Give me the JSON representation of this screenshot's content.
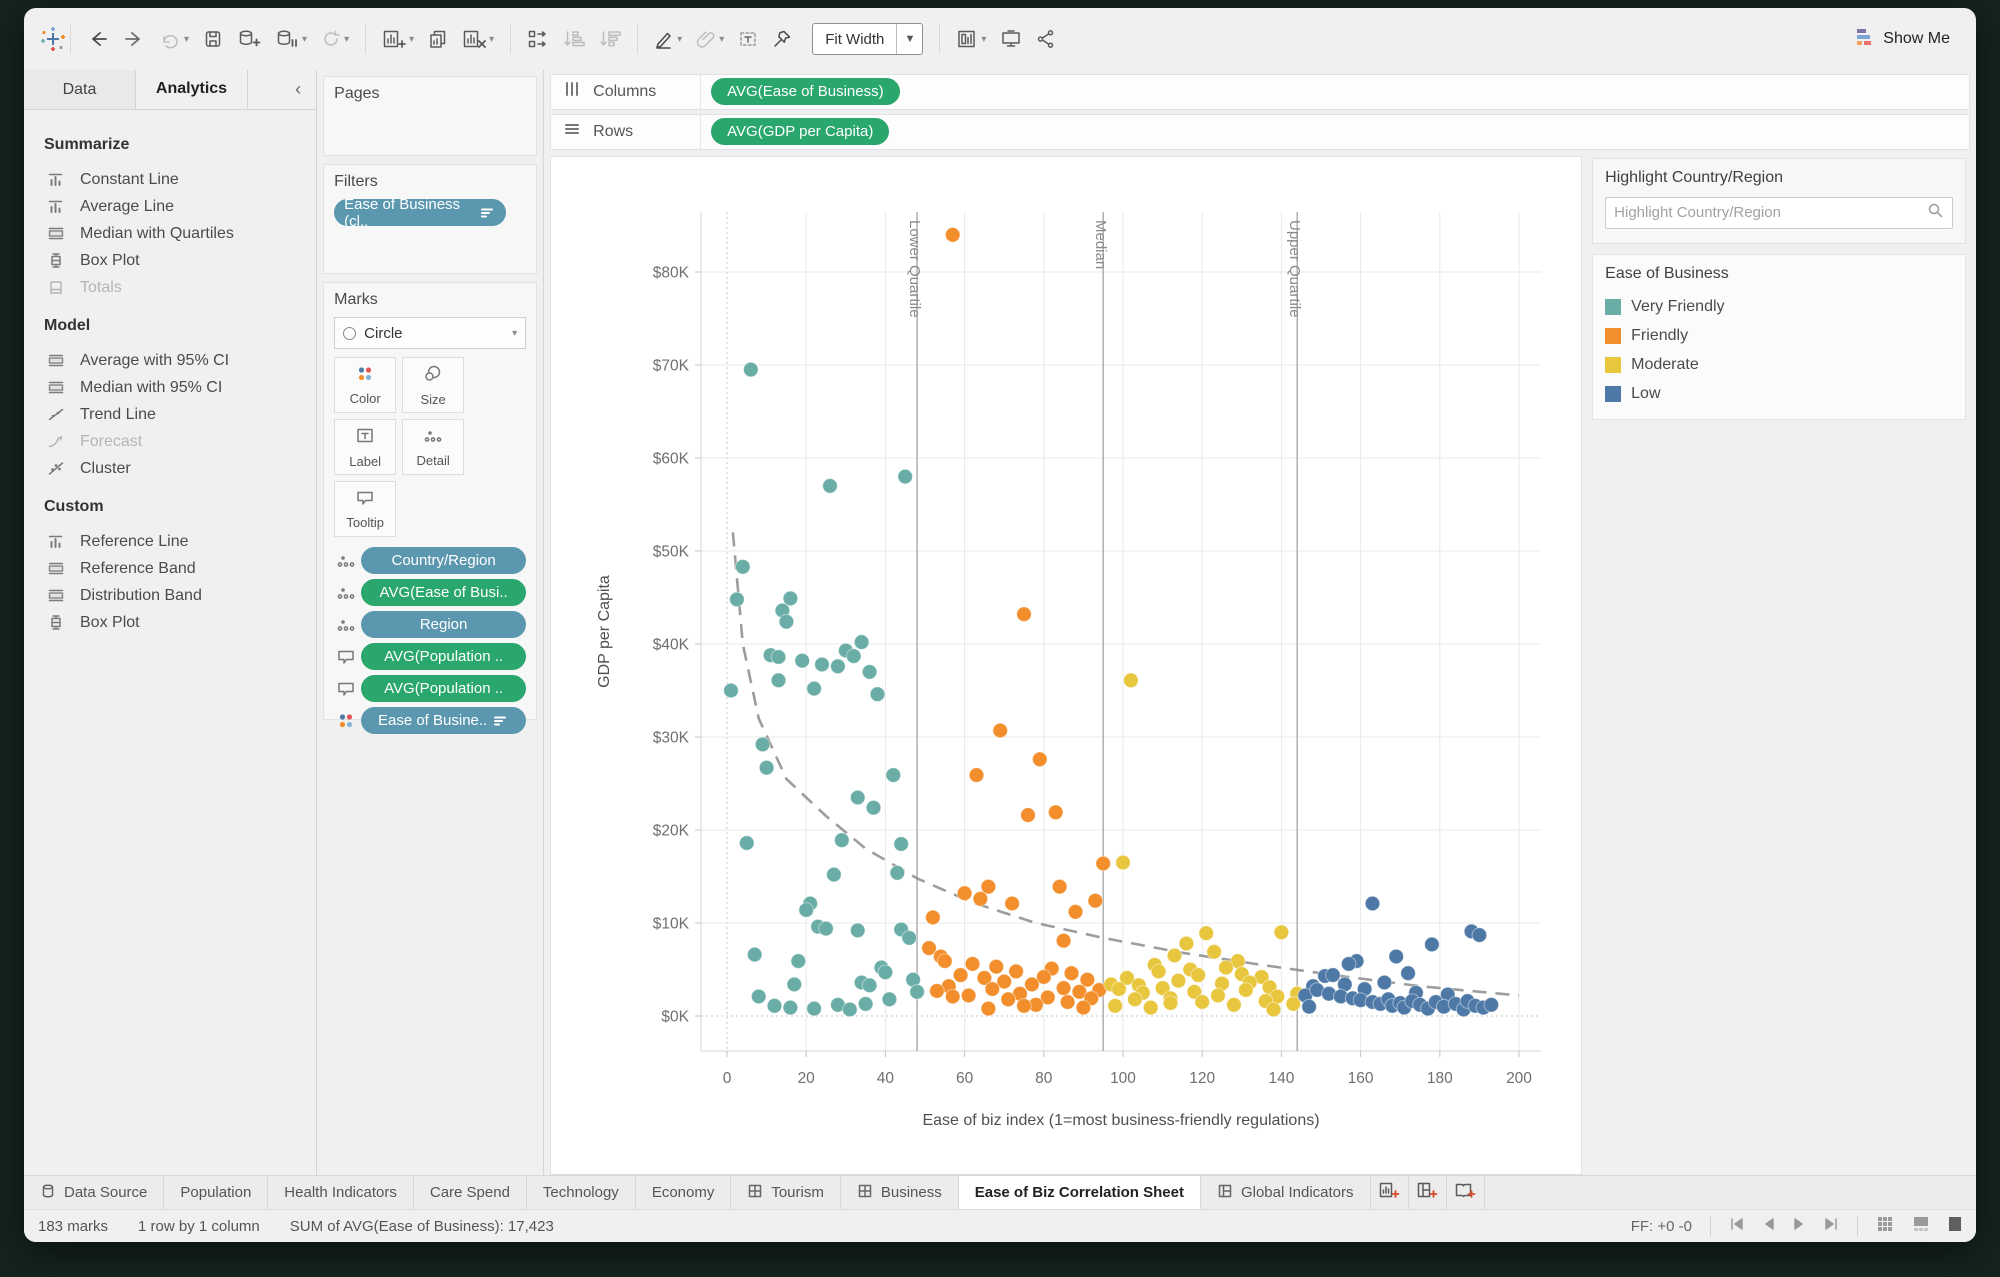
{
  "toolbar": {
    "fit_width": "Fit Width",
    "show_me": "Show Me"
  },
  "sidebar": {
    "tabs": [
      {
        "label": "Data"
      },
      {
        "label": "Analytics",
        "active": true
      }
    ],
    "sections": [
      {
        "title": "Summarize",
        "items": [
          {
            "label": "Constant Line",
            "icon": "ref-line"
          },
          {
            "label": "Average Line",
            "icon": "ref-line"
          },
          {
            "label": "Median with Quartiles",
            "icon": "band"
          },
          {
            "label": "Box Plot",
            "icon": "boxplot"
          },
          {
            "label": "Totals",
            "icon": "totals",
            "disabled": true
          }
        ]
      },
      {
        "title": "Model",
        "items": [
          {
            "label": "Average with 95% CI",
            "icon": "band"
          },
          {
            "label": "Median with 95% CI",
            "icon": "band"
          },
          {
            "label": "Trend Line",
            "icon": "trend"
          },
          {
            "label": "Forecast",
            "icon": "forecast",
            "disabled": true
          },
          {
            "label": "Cluster",
            "icon": "cluster"
          }
        ]
      },
      {
        "title": "Custom",
        "items": [
          {
            "label": "Reference Line",
            "icon": "ref-line"
          },
          {
            "label": "Reference Band",
            "icon": "band"
          },
          {
            "label": "Distribution Band",
            "icon": "band"
          },
          {
            "label": "Box Plot",
            "icon": "boxplot"
          }
        ]
      }
    ]
  },
  "shelves": {
    "pages_label": "Pages",
    "filters_label": "Filters",
    "filter_pills": [
      {
        "label": "Ease of Business (cl..",
        "color": "#5B98AF",
        "trailing_icon": "legend-bars"
      }
    ],
    "marks_label": "Marks",
    "mark_type": "Circle",
    "mark_buttons": [
      {
        "label": "Color",
        "icon": "color"
      },
      {
        "label": "Size",
        "icon": "size"
      },
      {
        "label": "Label",
        "icon": "label"
      },
      {
        "label": "Detail",
        "icon": "detail"
      },
      {
        "label": "Tooltip",
        "icon": "tooltip"
      }
    ],
    "mark_pills": [
      {
        "icon": "detail",
        "label": "Country/Region",
        "color": "#5B98AF"
      },
      {
        "icon": "detail",
        "label": "AVG(Ease of Busi..",
        "color": "#2AA76C"
      },
      {
        "icon": "detail",
        "label": "Region",
        "color": "#5B98AF"
      },
      {
        "icon": "tooltip",
        "label": "AVG(Population ..",
        "color": "#2AA76C"
      },
      {
        "icon": "tooltip",
        "label": "AVG(Population ..",
        "color": "#2AA76C"
      },
      {
        "icon": "color",
        "label": "Ease of Busine..",
        "color": "#5B98AF",
        "trailing_icon": "legend-bars"
      }
    ],
    "columns_label": "Columns",
    "columns_pills": [
      {
        "label": "AVG(Ease of Business)",
        "color": "#2AA76C"
      }
    ],
    "rows_label": "Rows",
    "rows_pills": [
      {
        "label": "AVG(GDP per Capita)",
        "color": "#2AA76C"
      }
    ]
  },
  "legend_panel": {
    "highlight_title": "Highlight Country/Region",
    "highlight_placeholder": "Highlight Country/Region",
    "legend_title": "Ease of Business",
    "items": [
      {
        "label": "Very Friendly",
        "color": "#69ADA6"
      },
      {
        "label": "Friendly",
        "color": "#F28E2B"
      },
      {
        "label": "Moderate",
        "color": "#E8C63E"
      },
      {
        "label": "Low",
        "color": "#4E79A7"
      }
    ]
  },
  "chart_data": {
    "type": "scatter",
    "xlabel": "Ease of biz index (1=most business-friendly regulations)",
    "ylabel": "GDP per Capita",
    "xlim": [
      0,
      200
    ],
    "ylim_k": [
      0,
      85
    ],
    "x_ticks": [
      0,
      20,
      40,
      60,
      80,
      100,
      120,
      140,
      160,
      180,
      200
    ],
    "y_ticks_k": [
      0,
      10,
      20,
      30,
      40,
      50,
      60,
      70,
      80
    ],
    "y_tick_format": "$NK",
    "grid": true,
    "legend_position": "right-panel",
    "reference_lines": [
      {
        "x": 48,
        "label": "Lower Quartile"
      },
      {
        "x": 95,
        "label": "Median"
      },
      {
        "x": 144,
        "label": "Upper Quartile"
      }
    ],
    "trend_line": {
      "style": "dashed",
      "points": [
        [
          1.5,
          52
        ],
        [
          4,
          40
        ],
        [
          8,
          32
        ],
        [
          15,
          25.5
        ],
        [
          25,
          21.5
        ],
        [
          35,
          18
        ],
        [
          48,
          14.8
        ],
        [
          62,
          12.2
        ],
        [
          78,
          10
        ],
        [
          95,
          8.4
        ],
        [
          115,
          6.8
        ],
        [
          135,
          5.5
        ],
        [
          155,
          4.3
        ],
        [
          175,
          3.2
        ],
        [
          200,
          2.2
        ]
      ]
    },
    "series": [
      {
        "name": "Very Friendly",
        "color": "#69ADA6",
        "points": [
          [
            6,
            69.5
          ],
          [
            26,
            57
          ],
          [
            45,
            58
          ],
          [
            4,
            48.3
          ],
          [
            2.5,
            44.8
          ],
          [
            16,
            44.9
          ],
          [
            14,
            43.6
          ],
          [
            15,
            42.4
          ],
          [
            1,
            35
          ],
          [
            11,
            38.8
          ],
          [
            13,
            38.6
          ],
          [
            19,
            38.2
          ],
          [
            24,
            37.8
          ],
          [
            28,
            37.6
          ],
          [
            30,
            39.3
          ],
          [
            32,
            38.7
          ],
          [
            34,
            40.2
          ],
          [
            36,
            37
          ],
          [
            13,
            36.1
          ],
          [
            22,
            35.2
          ],
          [
            38,
            34.6
          ],
          [
            9,
            29.2
          ],
          [
            10,
            26.7
          ],
          [
            42,
            25.9
          ],
          [
            33,
            23.5
          ],
          [
            37,
            22.4
          ],
          [
            5,
            18.6
          ],
          [
            29,
            18.9
          ],
          [
            44,
            18.5
          ],
          [
            27,
            15.2
          ],
          [
            43,
            15.4
          ],
          [
            21,
            12.1
          ],
          [
            20,
            11.4
          ],
          [
            23,
            9.6
          ],
          [
            25,
            9.4
          ],
          [
            33,
            9.2
          ],
          [
            44,
            9.3
          ],
          [
            46,
            8.4
          ],
          [
            7,
            6.6
          ],
          [
            18,
            5.9
          ],
          [
            39,
            5.2
          ],
          [
            40,
            4.7
          ],
          [
            34,
            3.6
          ],
          [
            36,
            3.3
          ],
          [
            17,
            3.4
          ],
          [
            8,
            2.1
          ],
          [
            12,
            1.1
          ],
          [
            16,
            0.9
          ],
          [
            22,
            0.8
          ],
          [
            28,
            1.2
          ],
          [
            31,
            0.7
          ],
          [
            35,
            1.3
          ],
          [
            47,
            3.9
          ],
          [
            48,
            2.6
          ],
          [
            41,
            1.8
          ]
        ]
      },
      {
        "name": "Friendly",
        "color": "#F28E2B",
        "points": [
          [
            57,
            84
          ],
          [
            75,
            43.2
          ],
          [
            69,
            30.7
          ],
          [
            79,
            27.6
          ],
          [
            63,
            25.9
          ],
          [
            83,
            21.9
          ],
          [
            76,
            21.6
          ],
          [
            95,
            16.4
          ],
          [
            66,
            13.9
          ],
          [
            84,
            13.9
          ],
          [
            60,
            13.2
          ],
          [
            64,
            12.6
          ],
          [
            72,
            12.1
          ],
          [
            93,
            12.4
          ],
          [
            88,
            11.2
          ],
          [
            52,
            10.6
          ],
          [
            85,
            8.1
          ],
          [
            51,
            7.3
          ],
          [
            54,
            6.4
          ],
          [
            55,
            5.9
          ],
          [
            62,
            5.6
          ],
          [
            68,
            5.3
          ],
          [
            82,
            5.1
          ],
          [
            73,
            4.8
          ],
          [
            87,
            4.6
          ],
          [
            59,
            4.4
          ],
          [
            80,
            4.2
          ],
          [
            65,
            4.1
          ],
          [
            91,
            3.9
          ],
          [
            70,
            3.7
          ],
          [
            77,
            3.4
          ],
          [
            56,
            3.2
          ],
          [
            85,
            3.0
          ],
          [
            67,
            2.9
          ],
          [
            94,
            2.8
          ],
          [
            53,
            2.7
          ],
          [
            89,
            2.6
          ],
          [
            74,
            2.4
          ],
          [
            61,
            2.2
          ],
          [
            57,
            2.1
          ],
          [
            81,
            2.0
          ],
          [
            92,
            1.9
          ],
          [
            71,
            1.8
          ],
          [
            86,
            1.5
          ],
          [
            78,
            1.2
          ],
          [
            75,
            1.1
          ],
          [
            90,
            0.9
          ],
          [
            66,
            0.8
          ]
        ]
      },
      {
        "name": "Moderate",
        "color": "#E8C63E",
        "points": [
          [
            102,
            36.1
          ],
          [
            100,
            16.5
          ],
          [
            121,
            8.9
          ],
          [
            140,
            9.0
          ],
          [
            116,
            7.8
          ],
          [
            123,
            6.9
          ],
          [
            113,
            6.5
          ],
          [
            129,
            5.9
          ],
          [
            108,
            5.5
          ],
          [
            126,
            5.2
          ],
          [
            117,
            5.0
          ],
          [
            109,
            4.8
          ],
          [
            130,
            4.5
          ],
          [
            119,
            4.4
          ],
          [
            135,
            4.2
          ],
          [
            101,
            4.1
          ],
          [
            114,
            3.8
          ],
          [
            132,
            3.6
          ],
          [
            125,
            3.5
          ],
          [
            97,
            3.4
          ],
          [
            104,
            3.3
          ],
          [
            137,
            3.1
          ],
          [
            110,
            3.0
          ],
          [
            99,
            2.9
          ],
          [
            131,
            2.8
          ],
          [
            118,
            2.6
          ],
          [
            105,
            2.5
          ],
          [
            144,
            2.4
          ],
          [
            124,
            2.2
          ],
          [
            139,
            2.1
          ],
          [
            112,
            1.9
          ],
          [
            103,
            1.8
          ],
          [
            136,
            1.6
          ],
          [
            120,
            1.5
          ],
          [
            112,
            1.4
          ],
          [
            143,
            1.3
          ],
          [
            128,
            1.2
          ],
          [
            98,
            1.1
          ],
          [
            107,
            0.9
          ],
          [
            138,
            0.7
          ]
        ]
      },
      {
        "name": "Low",
        "color": "#4E79A7",
        "points": [
          [
            163,
            12.1
          ],
          [
            188,
            9.1
          ],
          [
            190,
            8.7
          ],
          [
            178,
            7.7
          ],
          [
            169,
            6.4
          ],
          [
            159,
            5.9
          ],
          [
            157,
            5.6
          ],
          [
            172,
            4.6
          ],
          [
            151,
            4.3
          ],
          [
            153,
            4.4
          ],
          [
            166,
            3.6
          ],
          [
            148,
            3.2
          ],
          [
            161,
            2.9
          ],
          [
            156,
            3.4
          ],
          [
            146,
            2.2
          ],
          [
            149,
            2.8
          ],
          [
            174,
            2.5
          ],
          [
            182,
            2.3
          ],
          [
            152,
            2.4
          ],
          [
            155,
            2.1
          ],
          [
            158,
            1.9
          ],
          [
            160,
            1.7
          ],
          [
            163,
            1.5
          ],
          [
            165,
            1.3
          ],
          [
            167,
            1.8
          ],
          [
            168,
            1.1
          ],
          [
            170,
            1.4
          ],
          [
            171,
            0.9
          ],
          [
            173,
            1.6
          ],
          [
            175,
            1.2
          ],
          [
            177,
            0.8
          ],
          [
            179,
            1.5
          ],
          [
            181,
            1.0
          ],
          [
            184,
            1.3
          ],
          [
            186,
            0.7
          ],
          [
            187,
            1.6
          ],
          [
            189,
            1.1
          ],
          [
            191,
            0.9
          ],
          [
            193,
            1.2
          ],
          [
            147,
            1.0
          ]
        ]
      }
    ]
  },
  "sheet_tabs": {
    "tabs": [
      {
        "label": "Data Source",
        "icon": "database"
      },
      {
        "label": "Population"
      },
      {
        "label": "Health Indicators"
      },
      {
        "label": "Care Spend"
      },
      {
        "label": "Technology"
      },
      {
        "label": "Economy"
      },
      {
        "label": "Tourism",
        "icon": "grid"
      },
      {
        "label": "Business",
        "icon": "grid"
      },
      {
        "label": "Ease of Biz Correlation Sheet",
        "active": true
      },
      {
        "label": "Global Indicators",
        "icon": "dashboard"
      }
    ],
    "add_buttons": [
      "new-worksheet",
      "new-dashboard",
      "new-story"
    ]
  },
  "status_bar": {
    "left_items": [
      "183 marks",
      "1 row by 1 column",
      "SUM of AVG(Ease of Business): 17,423"
    ],
    "right_text": "FF: +0 -0"
  }
}
